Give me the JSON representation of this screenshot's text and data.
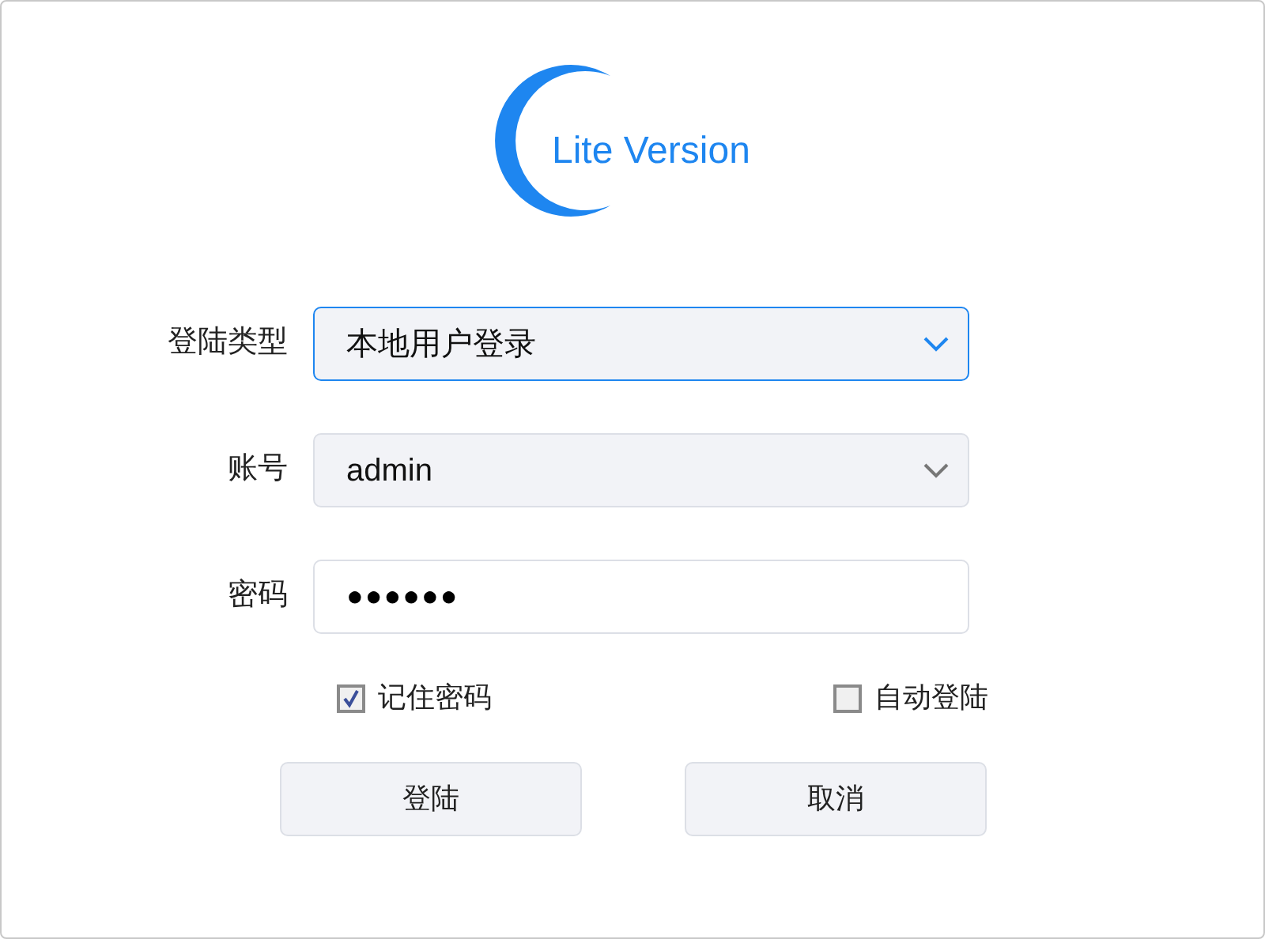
{
  "logo": {
    "text": "Lite Version"
  },
  "fields": [
    {
      "label": "登陆类型",
      "kind": "select",
      "value": "本地用户登录",
      "focused": true
    },
    {
      "label": "账号",
      "kind": "select",
      "value": "admin",
      "focused": false
    },
    {
      "label": "密码",
      "kind": "password",
      "value": "●●●●●●",
      "focused": false
    }
  ],
  "options": [
    {
      "label": "记住密码",
      "checked": true
    },
    {
      "label": "自动登陆",
      "checked": false
    }
  ],
  "buttons": [
    "登陆",
    "取消"
  ]
}
